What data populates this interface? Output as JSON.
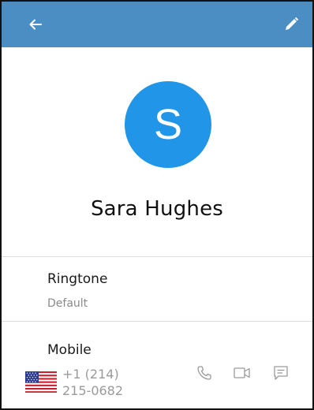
{
  "app_bar": {
    "background": "#4a8ec4",
    "back_icon": "arrow-left-icon",
    "edit_icon": "pencil-icon"
  },
  "contact": {
    "initial": "S",
    "avatar_color": "#2196e8",
    "name": "Sara Hughes"
  },
  "ringtone": {
    "title": "Ringtone",
    "value": "Default"
  },
  "phone": {
    "label": "Mobile",
    "country_flag": "us-flag-icon",
    "number_line1": "+1 (214)",
    "number_line2": "215-0682",
    "actions": [
      "phone-icon",
      "video-camera-icon",
      "message-icon"
    ]
  }
}
